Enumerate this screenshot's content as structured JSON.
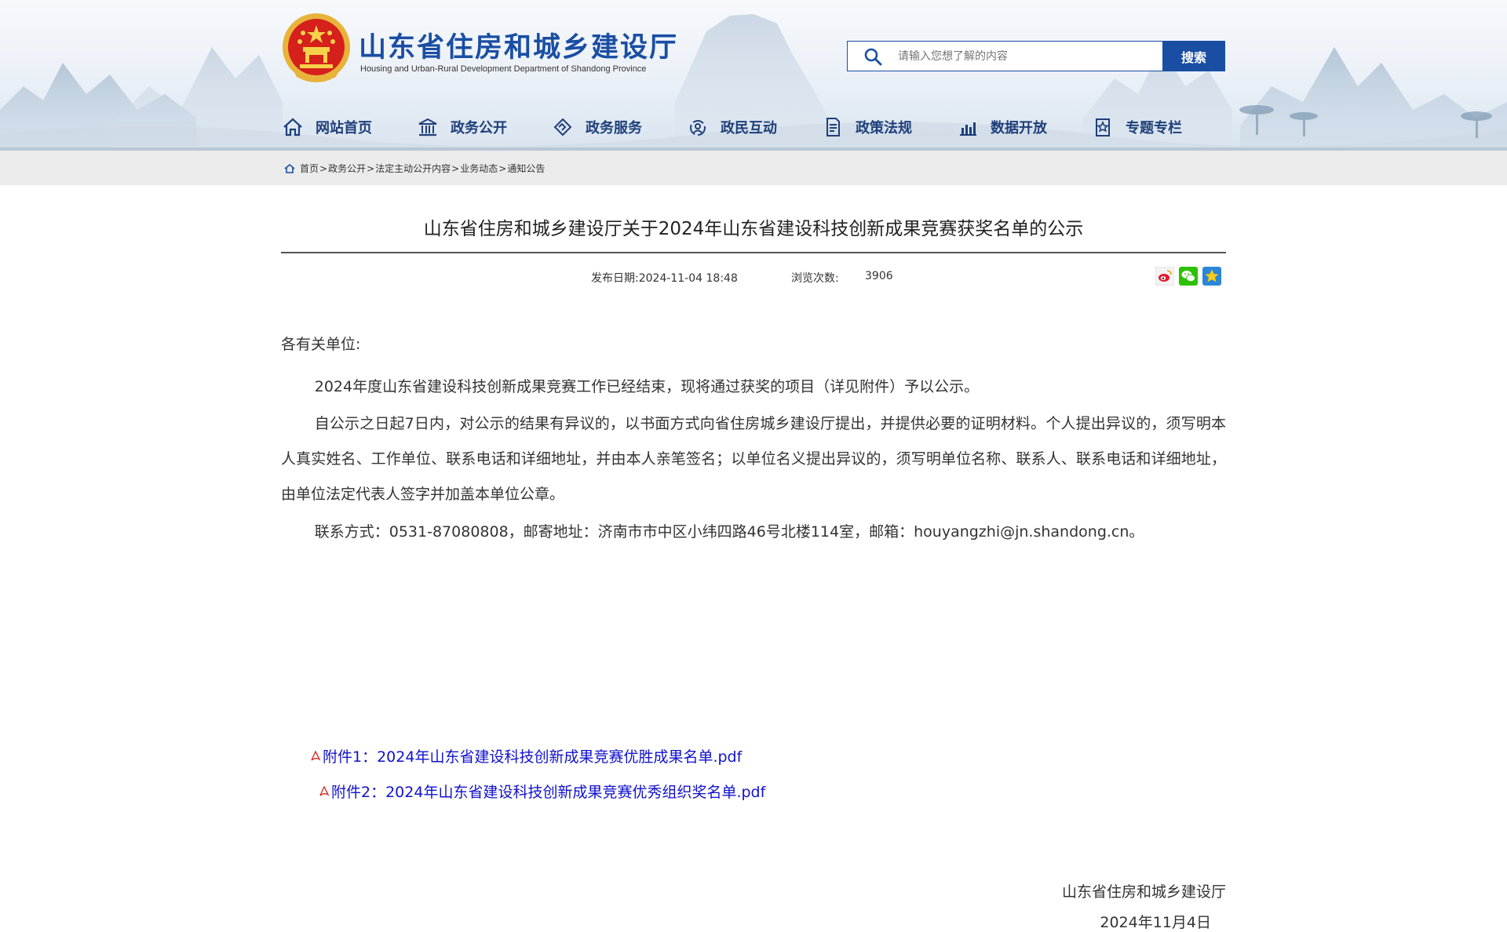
{
  "header": {
    "site_title": "山东省住房和城乡建设厅",
    "site_subtitle": "Housing and Urban-Rural Development Department of Shandong Province",
    "search": {
      "placeholder": "请输入您想了解的内容",
      "button_label": "搜索"
    },
    "nav": [
      {
        "label": "网站首页",
        "icon": "home-icon"
      },
      {
        "label": "政务公开",
        "icon": "government-building-icon"
      },
      {
        "label": "政务服务",
        "icon": "handshake-icon"
      },
      {
        "label": "政民互动",
        "icon": "interaction-icon"
      },
      {
        "label": "政策法规",
        "icon": "policy-document-icon"
      },
      {
        "label": "数据开放",
        "icon": "bar-chart-icon"
      },
      {
        "label": "专题专栏",
        "icon": "special-topic-icon"
      }
    ]
  },
  "breadcrumb": {
    "items": [
      "首页",
      "政务公开",
      "法定主动公开内容",
      "业务动态",
      "通知公告"
    ],
    "separator": ">"
  },
  "article": {
    "title": "山东省住房和城乡建设厅关于2024年山东省建设科技创新成果竞赛获奖名单的公示",
    "date": "发布日期:2024-11-04 18:48",
    "views_label": "浏览次数:",
    "views_value": "3906",
    "share_icons": [
      "weibo-icon",
      "wechat-icon",
      "qzone-icon"
    ],
    "salutation": "各有关单位:",
    "paragraphs": [
      "2024年度山东省建设科技创新成果竞赛工作已经结束，现将通过获奖的项目（详见附件）予以公示。",
      "自公示之日起7日内，对公示的结果有异议的，以书面方式向省住房城乡建设厅提出，并提供必要的证明材料。个人提出异议的，须写明本人真实姓名、工作单位、联系电话和详细地址，并由本人亲笔签名；以单位名义提出异议的，须写明单位名称、联系人、联系电话和详细地址，由单位法定代表人签字并加盖本单位公章。",
      "联系方式：0531-87080808，邮寄地址：济南市市中区小纬四路46号北楼114室，邮箱：houyangzhi@jn.shandong.cn。"
    ],
    "attachments": [
      "附件1：2024年山东省建设科技创新成果竞赛优胜成果名单.pdf",
      "附件2：2024年山东省建设科技创新成果竞赛优秀组织奖名单.pdf"
    ],
    "signature_org": "山东省住房和城乡建设厅",
    "signature_date": "2024年11月4日"
  },
  "colors": {
    "brand_blue": "#1a4ea3",
    "nav_text": "#1f3f7a",
    "link_blue": "#1111cc",
    "crumb_bg": "#ebebeb"
  }
}
